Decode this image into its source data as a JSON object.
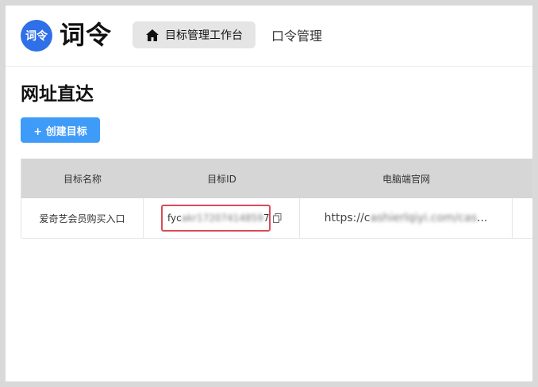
{
  "header": {
    "logo_text": "词令",
    "brand_name": "词令",
    "nav": {
      "active_label": "目标管理工作台",
      "item_label": "口令管理"
    }
  },
  "page": {
    "title": "网址直达",
    "create_button_label": "+ 创建目标"
  },
  "table": {
    "headers": [
      "目标名称",
      "目标ID",
      "电脑端官网"
    ],
    "rows": [
      {
        "name": "爱奇艺会员购买入口",
        "id_visible_prefix": "fyc",
        "id_obscured": "akr17207414859",
        "id_visible_suffix": "7",
        "url_prefix": "https://c",
        "url_obscured": "ashierlqiyi.com/cas",
        "url_suffix": "..."
      }
    ]
  },
  "colors": {
    "brand_blue": "#2f6fe8",
    "button_blue": "#3f9bf8",
    "highlight_red": "#d94a59",
    "header_gray": "#d6d6d6"
  },
  "icons": [
    "home-icon",
    "copy-icon"
  ]
}
